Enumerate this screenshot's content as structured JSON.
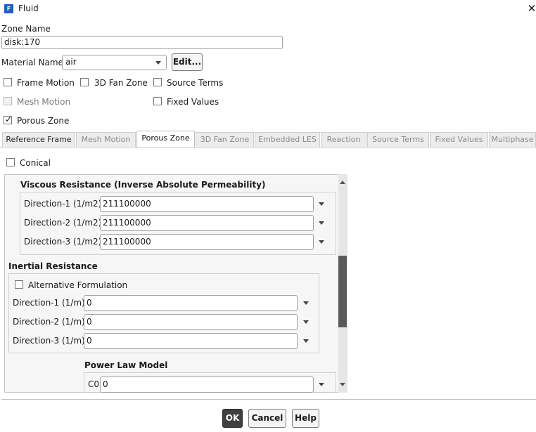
{
  "window": {
    "title": "Fluid",
    "icon": "fluent-app-icon",
    "close": "✕"
  },
  "zone_name": {
    "label": "Zone Name",
    "value": "disk:170"
  },
  "material": {
    "label": "Material Name",
    "value": "air",
    "edit_label": "Edit..."
  },
  "options": {
    "frame_motion": {
      "label": "Frame Motion",
      "checked": false
    },
    "fan_zone_3d": {
      "label": "3D Fan Zone",
      "checked": false
    },
    "source_terms": {
      "label": "Source Terms",
      "checked": false
    },
    "mesh_motion": {
      "label": "Mesh Motion",
      "checked": false,
      "disabled": true
    },
    "fixed_values": {
      "label": "Fixed Values",
      "checked": false
    },
    "porous_zone": {
      "label": "Porous Zone",
      "checked": true
    }
  },
  "tabs": [
    {
      "label": "Reference Frame"
    },
    {
      "label": "Mesh Motion"
    },
    {
      "label": "Porous Zone"
    },
    {
      "label": "3D Fan Zone"
    },
    {
      "label": "Embedded LES"
    },
    {
      "label": "Reaction"
    },
    {
      "label": "Source Terms"
    },
    {
      "label": "Fixed Values"
    },
    {
      "label": "Multiphase"
    }
  ],
  "active_tab": "Porous Zone",
  "porous": {
    "conical": {
      "label": "Conical",
      "checked": false
    },
    "viscous": {
      "title": "Viscous Resistance (Inverse Absolute Permeability)",
      "rows": [
        {
          "label": "Direction-1 (1/m2)",
          "value": "211100000"
        },
        {
          "label": "Direction-2 (1/m2)",
          "value": "211100000"
        },
        {
          "label": "Direction-3 (1/m2)",
          "value": "211100000"
        }
      ]
    },
    "inertial": {
      "title": "Inertial Resistance",
      "alt_formulation": {
        "label": "Alternative Formulation",
        "checked": false
      },
      "rows": [
        {
          "label": "Direction-1 (1/m)",
          "value": "0"
        },
        {
          "label": "Direction-2 (1/m)",
          "value": "0"
        },
        {
          "label": "Direction-3 (1/m)",
          "value": "0"
        }
      ]
    },
    "power_law": {
      "title": "Power Law Model",
      "c0_label": "C0",
      "c0_value": "0"
    }
  },
  "buttons": {
    "ok": "OK",
    "cancel": "Cancel",
    "help": "Help"
  },
  "colors": {
    "ok_bg": "#3f3f3f",
    "scroll_thumb": "#5a5a5a",
    "app_icon": "#1f5fbf"
  }
}
